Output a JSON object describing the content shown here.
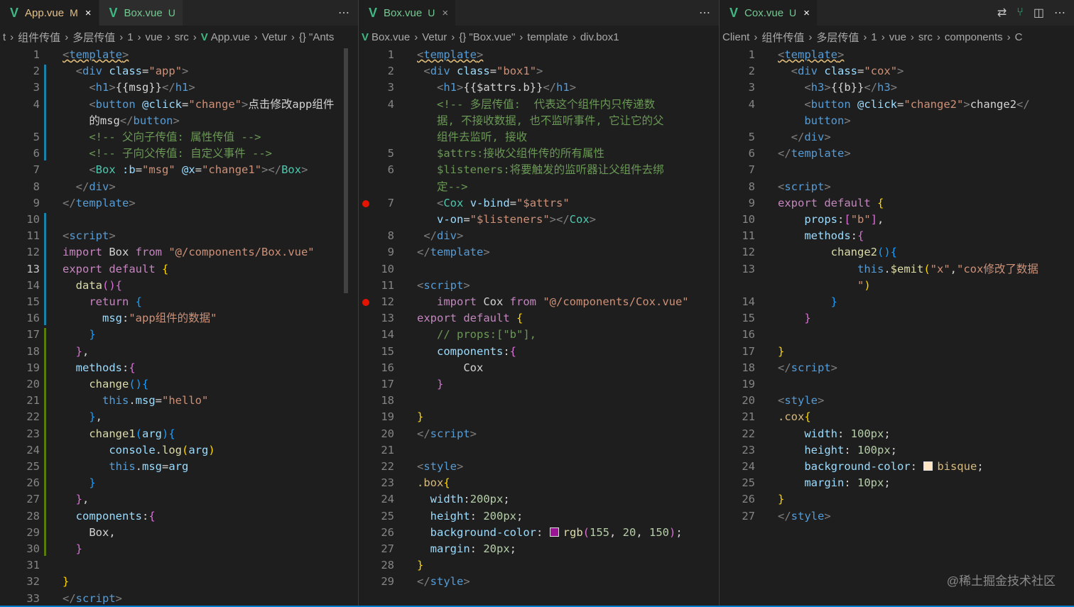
{
  "panes": [
    {
      "id": "app",
      "tabs": [
        {
          "name": "App.vue",
          "git": "M",
          "active": true,
          "close": "×"
        },
        {
          "name": "Box.vue",
          "git": "U",
          "active": false,
          "close": ""
        }
      ],
      "breadcrumb": [
        "t",
        "组件传值",
        "多层传值",
        "1",
        "vue",
        "src",
        "App.vue",
        "Vetur",
        "{} \"Ants"
      ],
      "current_line": 13,
      "lines": [
        {
          "n": "1",
          "html": "<span class='t sq'>&lt;</span><span class='tg sq'>template</span><span class='t sq'>&gt;</span>"
        },
        {
          "n": "2",
          "html": "  <span class='t'>&lt;</span><span class='tg'>div</span> <span class='at'>class</span>=<span class='st'>\"app\"</span><span class='t'>&gt;</span>"
        },
        {
          "n": "3",
          "html": "    <span class='t'>&lt;</span><span class='tg'>h1</span><span class='t'>&gt;</span>{{msg}}<span class='t'>&lt;/</span><span class='tg'>h1</span><span class='t'>&gt;</span>"
        },
        {
          "n": "4",
          "html": "    <span class='t'>&lt;</span><span class='tg'>button</span> <span class='at'>@click</span>=<span class='st'>\"change\"</span><span class='t'>&gt;</span>点击修改app组件"
        },
        {
          "n": "",
          "html": "    的msg<span class='t'>&lt;/</span><span class='tg'>button</span><span class='t'>&gt;</span>"
        },
        {
          "n": "5",
          "html": "    <span class='cm'>&lt;!-- 父向子传值: 属性传值 --&gt;</span>"
        },
        {
          "n": "6",
          "html": "    <span class='cm'>&lt;!-- 子向父传值: 自定义事件 --&gt;</span>"
        },
        {
          "n": "7",
          "html": "    <span class='t'>&lt;</span><span class='ty'>Box</span> <span class='at'>:b</span>=<span class='st'>\"msg\"</span> <span class='at'>@x</span>=<span class='st'>\"change1\"</span><span class='t'>&gt;&lt;/</span><span class='ty'>Box</span><span class='t'>&gt;</span>"
        },
        {
          "n": "8",
          "html": "  <span class='t'>&lt;/</span><span class='tg'>div</span><span class='t'>&gt;</span>"
        },
        {
          "n": "9",
          "html": "<span class='t'>&lt;/</span><span class='tg'>template</span><span class='t'>&gt;</span>"
        },
        {
          "n": "10",
          "html": ""
        },
        {
          "n": "11",
          "html": "<span class='t'>&lt;</span><span class='tg'>script</span><span class='t'>&gt;</span>"
        },
        {
          "n": "12",
          "html": "<span class='kw'>import</span> Box <span class='kw'>from</span> <span class='st'>\"@/components/Box.vue\"</span>"
        },
        {
          "n": "13",
          "html": "<span class='kw'>export</span> <span class='kw'>default</span> <span class='br1'>{</span>"
        },
        {
          "n": "14",
          "html": "  <span class='fn'>data</span><span class='br2'>()</span><span class='br2'>{</span>"
        },
        {
          "n": "15",
          "html": "    <span class='kw'>return</span> <span class='br3'>{</span>"
        },
        {
          "n": "16",
          "html": "      <span class='pr'>msg</span>:<span class='st'>\"app组件的数据\"</span>"
        },
        {
          "n": "17",
          "html": "    <span class='br3'>}</span>"
        },
        {
          "n": "18",
          "html": "  <span class='br2'>}</span>,"
        },
        {
          "n": "19",
          "html": "  <span class='pr'>methods</span>:<span class='br2'>{</span>"
        },
        {
          "n": "20",
          "html": "    <span class='fn'>change</span><span class='br3'>()</span><span class='br3'>{</span>"
        },
        {
          "n": "21",
          "html": "      <span class='tv'>this</span>.<span class='pr'>msg</span>=<span class='st'>\"hello\"</span>"
        },
        {
          "n": "22",
          "html": "    <span class='br3'>}</span>,"
        },
        {
          "n": "23",
          "html": "    <span class='fn'>change1</span><span class='br3'>(</span><span class='pr'>arg</span><span class='br3'>)</span><span class='br3'>{</span>"
        },
        {
          "n": "24",
          "html": "       <span class='pr'>console</span>.<span class='fn'>log</span><span class='br1'>(</span><span class='pr'>arg</span><span class='br1'>)</span>"
        },
        {
          "n": "25",
          "html": "       <span class='tv'>this</span>.<span class='pr'>msg</span>=<span class='pr'>arg</span>"
        },
        {
          "n": "26",
          "html": "    <span class='br3'>}</span>"
        },
        {
          "n": "27",
          "html": "  <span class='br2'>}</span>,"
        },
        {
          "n": "28",
          "html": "  <span class='pr'>components</span>:<span class='br2'>{</span>"
        },
        {
          "n": "29",
          "html": "    Box,"
        },
        {
          "n": "30",
          "html": "  <span class='br2'>}</span>"
        },
        {
          "n": "31",
          "html": ""
        },
        {
          "n": "32",
          "html": "<span class='br1'>}</span>"
        },
        {
          "n": "33",
          "html": "<span class='t'>&lt;/</span><span class='tg'>script</span><span class='t'>&gt;</span>"
        }
      ]
    },
    {
      "id": "box",
      "tabs": [
        {
          "name": "Box.vue",
          "git": "U",
          "active": true,
          "close": "×"
        }
      ],
      "breadcrumb": [
        "Box.vue",
        "Vetur",
        "{} \"Box.vue\"",
        "template",
        "div.box1"
      ],
      "current_line": 0,
      "lines": [
        {
          "n": "1",
          "html": "<span class='t sq'>&lt;</span><span class='tg sq'>template</span><span class='t sq'>&gt;</span>"
        },
        {
          "n": "2",
          "html": " <span class='t'>&lt;</span><span class='tg'>div</span> <span class='at'>class</span>=<span class='st'>\"box1\"</span><span class='t'>&gt;</span>"
        },
        {
          "n": "3",
          "html": "   <span class='t'>&lt;</span><span class='tg'>h1</span><span class='t'>&gt;</span>{{$attrs.b}}<span class='t'>&lt;/</span><span class='tg'>h1</span><span class='t'>&gt;</span>"
        },
        {
          "n": "4",
          "html": "   <span class='cm'>&lt;!-- 多层传值:  代表这个组件内只传递数</span>"
        },
        {
          "n": "",
          "html": "   <span class='cm'>据, 不接收数据, 也不监听事件, 它让它的父</span>"
        },
        {
          "n": "",
          "html": "   <span class='cm'>组件去监听, 接收</span>"
        },
        {
          "n": "5",
          "html": "   <span class='cm'>$attrs:接收父组件传的所有属性</span>"
        },
        {
          "n": "6",
          "html": "   <span class='cm'>$listeners:将要触发的监听器让父组件去绑</span>"
        },
        {
          "n": "",
          "html": "   <span class='cm'>定--&gt;</span>"
        },
        {
          "n": "7",
          "bp": true,
          "html": "   <span class='t'>&lt;</span><span class='ty'>Cox</span> <span class='at'>v-bind</span>=<span class='st'>\"$attrs\"</span>"
        },
        {
          "n": "",
          "html": "   <span class='at'>v-on</span>=<span class='st'>\"$listeners\"</span><span class='t'>&gt;&lt;/</span><span class='ty'>Cox</span><span class='t'>&gt;</span>"
        },
        {
          "n": "8",
          "html": " <span class='t'>&lt;/</span><span class='tg'>div</span><span class='t'>&gt;</span>"
        },
        {
          "n": "9",
          "html": "<span class='t'>&lt;/</span><span class='tg'>template</span><span class='t'>&gt;</span>"
        },
        {
          "n": "10",
          "html": ""
        },
        {
          "n": "11",
          "html": "<span class='t'>&lt;</span><span class='tg'>script</span><span class='t'>&gt;</span>"
        },
        {
          "n": "12",
          "bp": true,
          "html": "   <span class='kw'>import</span> Cox <span class='kw'>from</span> <span class='st'>\"@/components/Cox.vue\"</span>"
        },
        {
          "n": "13",
          "html": "<span class='kw'>export</span> <span class='kw'>default</span> <span class='br1'>{</span>"
        },
        {
          "n": "14",
          "html": "   <span class='cm'>// props:[\"b\"],</span>"
        },
        {
          "n": "15",
          "html": "   <span class='pr'>components</span>:<span class='br2'>{</span>"
        },
        {
          "n": "16",
          "html": "       Cox"
        },
        {
          "n": "17",
          "html": "   <span class='br2'>}</span>"
        },
        {
          "n": "18",
          "html": ""
        },
        {
          "n": "19",
          "html": "<span class='br1'>}</span>"
        },
        {
          "n": "20",
          "html": "<span class='t'>&lt;/</span><span class='tg'>script</span><span class='t'>&gt;</span>"
        },
        {
          "n": "21",
          "html": ""
        },
        {
          "n": "22",
          "html": "<span class='t'>&lt;</span><span class='tg'>style</span><span class='t'>&gt;</span>"
        },
        {
          "n": "23",
          "html": "<span class='cls'>.box</span><span class='br1'>{</span>"
        },
        {
          "n": "24",
          "html": "  <span class='pr'>width</span>:<span class='num'>200px</span>;"
        },
        {
          "n": "25",
          "html": "  <span class='pr'>height</span>: <span class='num'>200px</span>;"
        },
        {
          "n": "26",
          "html": "  <span class='pr'>background-color</span>: <span class='swatch' style='background:#9b1496'></span><span class='fn'>rgb</span><span class='br2'>(</span><span class='num'>155</span>, <span class='num'>20</span>, <span class='num'>150</span><span class='br2'>)</span>;"
        },
        {
          "n": "27",
          "html": "  <span class='pr'>margin</span>: <span class='num'>20px</span>;"
        },
        {
          "n": "28",
          "html": "<span class='br1'>}</span>"
        },
        {
          "n": "29",
          "html": "<span class='t'>&lt;/</span><span class='tg'>style</span><span class='t'>&gt;</span>"
        }
      ]
    },
    {
      "id": "cox",
      "tabs": [
        {
          "name": "Cox.vue",
          "git": "U",
          "active": true,
          "close": "×"
        }
      ],
      "breadcrumb": [
        "Client",
        "组件传值",
        "多层传值",
        "1",
        "vue",
        "src",
        "components",
        "C"
      ],
      "current_line": 0,
      "lines": [
        {
          "n": "1",
          "html": "<span class='t sq'>&lt;</span><span class='tg sq'>template</span><span class='t sq'>&gt;</span>"
        },
        {
          "n": "2",
          "html": "  <span class='t'>&lt;</span><span class='tg'>div</span> <span class='at'>class</span>=<span class='st'>\"cox\"</span><span class='t'>&gt;</span>"
        },
        {
          "n": "3",
          "html": "    <span class='t'>&lt;</span><span class='tg'>h3</span><span class='t'>&gt;</span>{{b}}<span class='t'>&lt;/</span><span class='tg'>h3</span><span class='t'>&gt;</span>"
        },
        {
          "n": "4",
          "html": "    <span class='t'>&lt;</span><span class='tg'>button</span> <span class='at'>@click</span>=<span class='st'>\"change2\"</span><span class='t'>&gt;</span>change2<span class='t'>&lt;/</span>"
        },
        {
          "n": "",
          "html": "    <span class='tg'>button</span><span class='t'>&gt;</span>"
        },
        {
          "n": "5",
          "html": "  <span class='t'>&lt;/</span><span class='tg'>div</span><span class='t'>&gt;</span>"
        },
        {
          "n": "6",
          "html": "<span class='t'>&lt;/</span><span class='tg'>template</span><span class='t'>&gt;</span>"
        },
        {
          "n": "7",
          "html": ""
        },
        {
          "n": "8",
          "html": "<span class='t'>&lt;</span><span class='tg'>script</span><span class='t'>&gt;</span>"
        },
        {
          "n": "9",
          "html": "<span class='kw'>export</span> <span class='kw'>default</span> <span class='br1'>{</span>"
        },
        {
          "n": "10",
          "html": "    <span class='pr'>props</span>:<span class='br2'>[</span><span class='st'>\"b\"</span><span class='br2'>]</span>,"
        },
        {
          "n": "11",
          "html": "    <span class='pr'>methods</span>:<span class='br2'>{</span>"
        },
        {
          "n": "12",
          "html": "        <span class='fn'>change2</span><span class='br3'>()</span><span class='br3'>{</span>"
        },
        {
          "n": "13",
          "html": "            <span class='tv'>this</span>.<span class='fn'>$emit</span><span class='br1'>(</span><span class='st'>\"x\"</span>,<span class='st'>\"cox修改了数据</span>"
        },
        {
          "n": "",
          "html": "            <span class='st'>\"</span><span class='br1'>)</span>"
        },
        {
          "n": "14",
          "html": "        <span class='br3'>}</span>"
        },
        {
          "n": "15",
          "html": "    <span class='br2'>}</span>"
        },
        {
          "n": "16",
          "html": ""
        },
        {
          "n": "17",
          "html": "<span class='br1'>}</span>"
        },
        {
          "n": "18",
          "html": "<span class='t'>&lt;/</span><span class='tg'>script</span><span class='t'>&gt;</span>"
        },
        {
          "n": "19",
          "html": ""
        },
        {
          "n": "20",
          "html": "<span class='t'>&lt;</span><span class='tg'>style</span><span class='t'>&gt;</span>"
        },
        {
          "n": "21",
          "html": "<span class='cls'>.cox</span><span class='br1'>{</span>"
        },
        {
          "n": "22",
          "html": "    <span class='pr'>width</span>: <span class='num'>100px</span>;"
        },
        {
          "n": "23",
          "html": "    <span class='pr'>height</span>: <span class='num'>100px</span>;"
        },
        {
          "n": "24",
          "html": "    <span class='pr'>background-color</span>: <span class='swatch' style='background:#ffe4c4'></span><span class='cls'>bisque</span>;"
        },
        {
          "n": "25",
          "html": "    <span class='pr'>margin</span>: <span class='num'>10px</span>;"
        },
        {
          "n": "26",
          "html": "<span class='br1'>}</span>"
        },
        {
          "n": "27",
          "html": "<span class='t'>&lt;/</span><span class='tg'>style</span><span class='t'>&gt;</span>"
        }
      ]
    }
  ],
  "tab_actions": {
    "more": "⋯",
    "compare": "⇄",
    "branch": "⑂",
    "split": "◫"
  },
  "watermark": "@稀土掘金技术社区",
  "colors": {
    "accent": "#007acc",
    "vue": "#41b883",
    "breakpoint": "#e51400"
  }
}
